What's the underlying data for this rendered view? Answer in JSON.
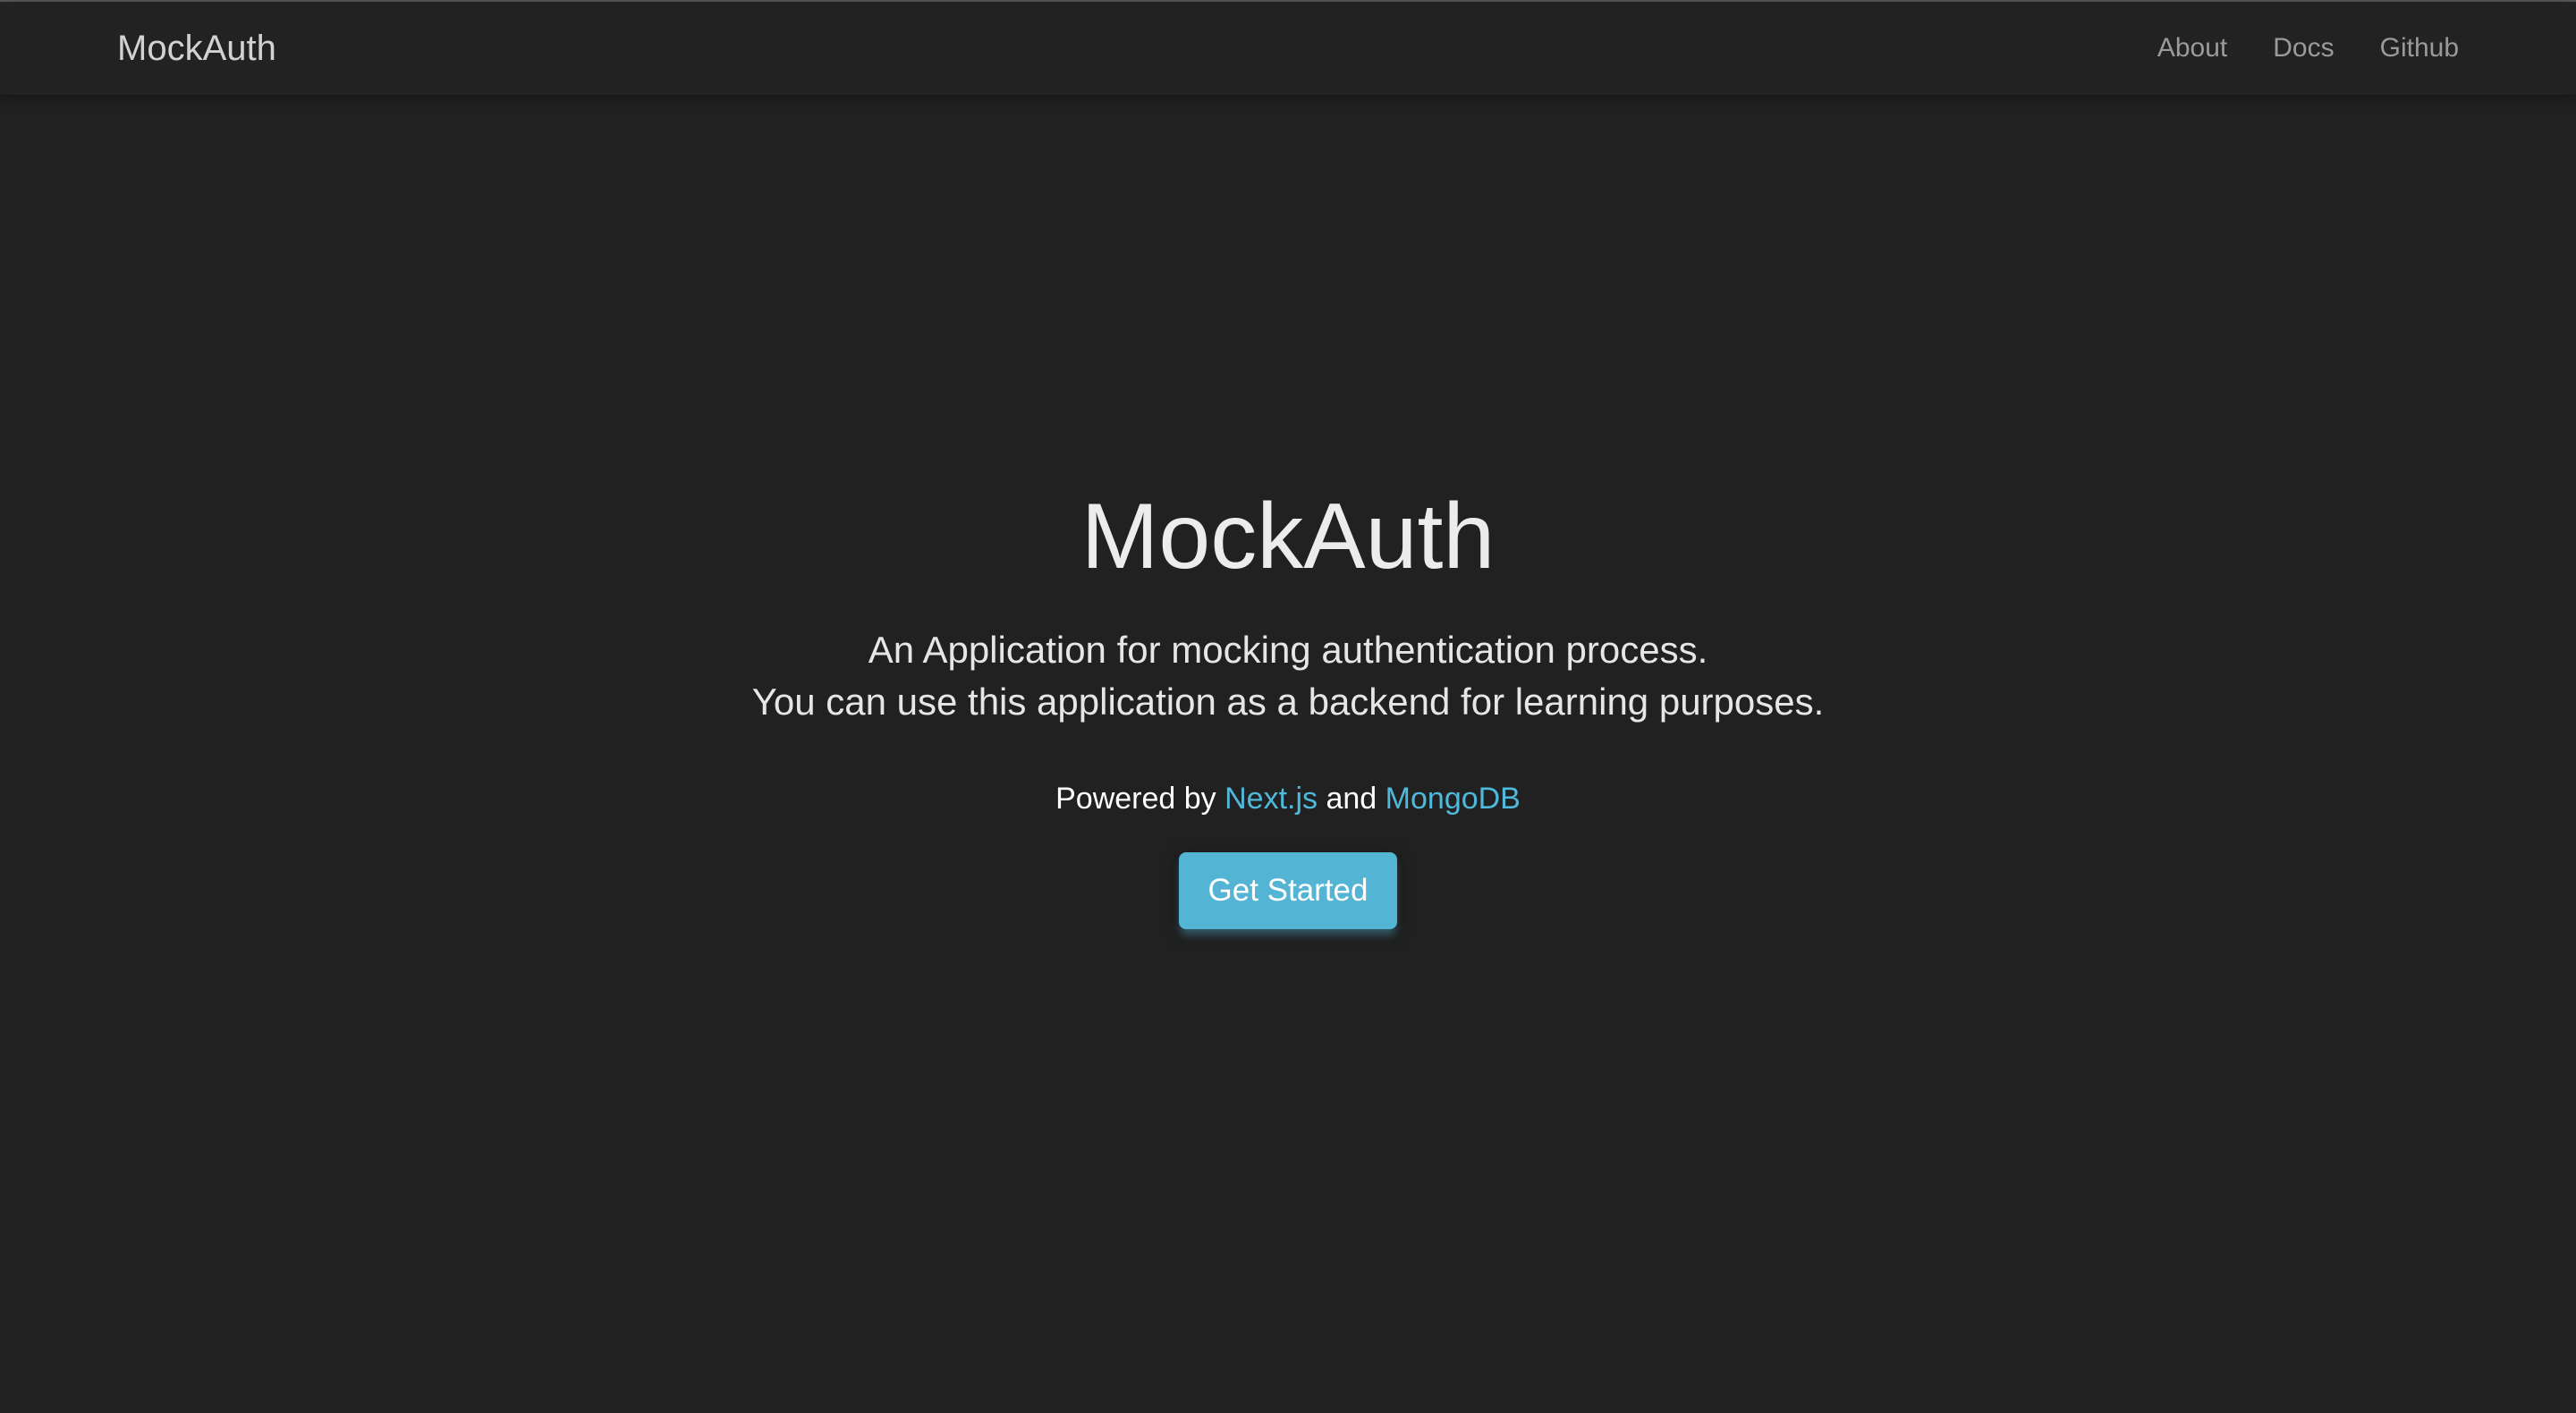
{
  "navbar": {
    "brand": "MockAuth",
    "links": [
      {
        "label": "About"
      },
      {
        "label": "Docs"
      },
      {
        "label": "Github"
      }
    ]
  },
  "hero": {
    "title": "MockAuth",
    "description_line1": "An Application for mocking authentication process.",
    "description_line2": "You can use this application as a backend for learning purposes.",
    "powered_prefix": "Powered by",
    "powered_link1": "Next.js",
    "powered_joiner": "and",
    "powered_link2": "MongoDB",
    "cta_label": "Get Started"
  },
  "colors": {
    "background": "#212121",
    "accent": "#54b4d3",
    "link": "#4fb9dc"
  }
}
